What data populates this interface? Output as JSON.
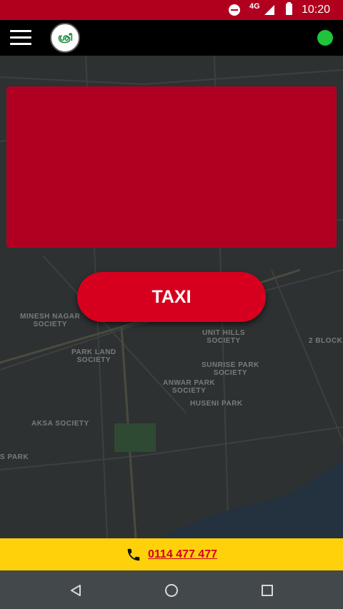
{
  "status_bar": {
    "network": "4G",
    "time": "10:20",
    "icons": [
      "do-not-disturb-icon",
      "signal-icon",
      "battery-icon"
    ]
  },
  "app_bar": {
    "logo_text": "ശ്രീ",
    "menu_icon": "hamburger-menu-icon",
    "status_indicator_color": "#1fc43b"
  },
  "map": {
    "labels": [
      {
        "id": "minesh",
        "text": "MINESH NAGAR\nSOCIETY"
      },
      {
        "id": "parkland",
        "text": "PARK LAND\nSOCIETY"
      },
      {
        "id": "unithills",
        "text": "UNIT HILLS\nSOCIETY"
      },
      {
        "id": "sunrise",
        "text": "SUNRISE PARK\nSOCIETY"
      },
      {
        "id": "anwar",
        "text": "ANWAR PARK\nSOCIETY"
      },
      {
        "id": "huseni",
        "text": "HUSENI PARK"
      },
      {
        "id": "aksa",
        "text": "AKSA SOCIETY"
      },
      {
        "id": "block",
        "text": "2 BLOCK"
      },
      {
        "id": "spark",
        "text": "S PARK"
      }
    ]
  },
  "banner": {
    "color": "#af0022"
  },
  "taxi_button": {
    "label": "TAXI"
  },
  "call_bar": {
    "phone_number": "0114 477 477"
  },
  "nav_bar": {
    "icons": [
      "back-icon",
      "home-icon",
      "recent-apps-icon"
    ]
  },
  "colors": {
    "brand_red": "#d6001e",
    "status_red": "#b0001e",
    "call_bar_yellow": "#ffd10a"
  }
}
